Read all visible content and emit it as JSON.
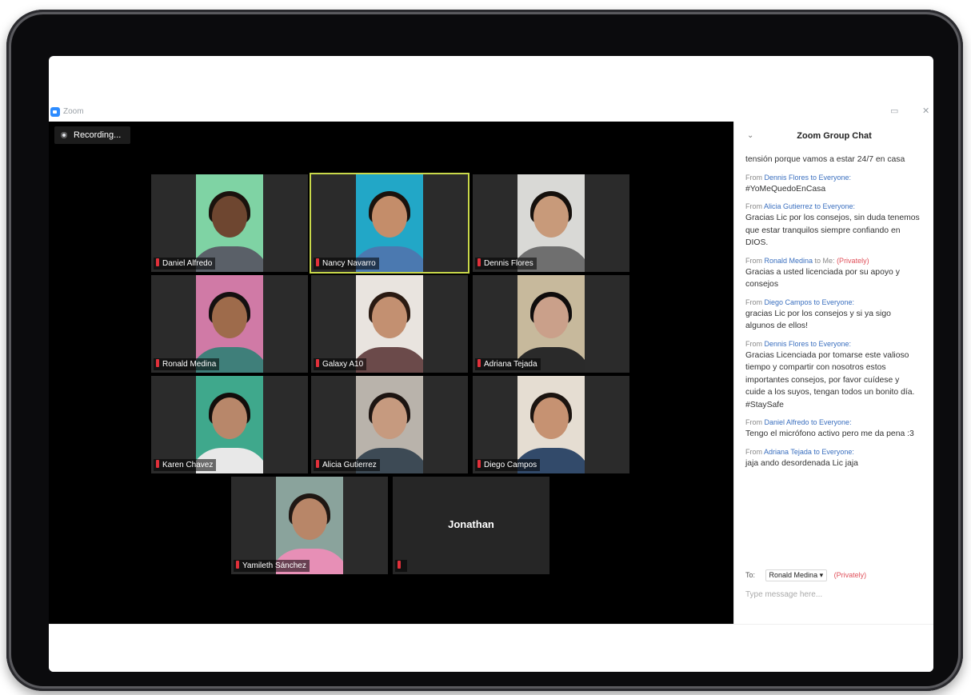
{
  "app": {
    "title": "Zoom",
    "minimize": "▭",
    "close": "✕"
  },
  "recording": {
    "label": "Recording..."
  },
  "participants": [
    {
      "name": "Daniel Alfredo",
      "bg": "#7fd3a4",
      "skin": "#6e4630",
      "hair": "#1a120d",
      "shirt": "#5a6068"
    },
    {
      "name": "Nancy Navarro",
      "bg": "#22a7c7",
      "skin": "#c48d6a",
      "hair": "#1a120d",
      "shirt": "#4b79b0",
      "active": true
    },
    {
      "name": "Dennis Flores",
      "bg": "#d9d9d6",
      "skin": "#c89a7a",
      "hair": "#15100c",
      "shirt": "#6f6f6f"
    },
    {
      "name": "Ronald Medina",
      "bg": "#d07aa6",
      "skin": "#9e6b4b",
      "hair": "#141010",
      "shirt": "#3f7f7a"
    },
    {
      "name": "Galaxy A10",
      "bg": "#e9e4df",
      "skin": "#c39071",
      "hair": "#2a1a12",
      "shirt": "#6b4a4a"
    },
    {
      "name": "Adriana Tejada",
      "bg": "#c7b99c",
      "skin": "#caa08a",
      "hair": "#0f0c0c",
      "shirt": "#2a2a2a"
    },
    {
      "name": "Karen Chavez",
      "bg": "#3fa88c",
      "skin": "#b8876a",
      "hair": "#120d0b",
      "shirt": "#e8e8e8"
    },
    {
      "name": "Alicia Gutierrez",
      "bg": "#b9b3ab",
      "skin": "#c69a7f",
      "hair": "#1c1411",
      "shirt": "#3d4a55"
    },
    {
      "name": "Diego Campos",
      "bg": "#e5ddd2",
      "skin": "#c69272",
      "hair": "#1b1410",
      "shirt": "#324a6a"
    },
    {
      "name": "Yamileth Sánchez",
      "bg": "#8aa39c",
      "skin": "#b88668",
      "hair": "#1f1713",
      "shirt": "#e78fb6"
    },
    {
      "name": "Jonathan",
      "no_video": true
    }
  ],
  "chat": {
    "title": "Zoom Group Chat",
    "messages": [
      {
        "from_name": "",
        "from_suffix": "",
        "private": "",
        "text": "tensión porque vamos a estar 24/7 en casa"
      },
      {
        "from_name": "Dennis Flores to Everyone:",
        "from_suffix": "",
        "private": "",
        "text": "#YoMeQuedoEnCasa"
      },
      {
        "from_name": "Alicia Gutierrez to Everyone:",
        "from_suffix": "",
        "private": "",
        "text": "Gracias Lic por los consejos, sin duda tenemos que estar tranquilos siempre confiando en DIOS."
      },
      {
        "from_name": "Ronald Medina",
        "from_suffix": "to Me:",
        "private": "(Privately)",
        "text": "Gracias a usted licenciada por su apoyo y consejos"
      },
      {
        "from_name": "Diego Campos to Everyone:",
        "from_suffix": "",
        "private": "",
        "text": "gracias Lic por los consejos y si ya sigo algunos de ellos!"
      },
      {
        "from_name": "Dennis Flores to Everyone:",
        "from_suffix": "",
        "private": "",
        "text": "Gracias Licenciada por tomarse este valioso tiempo y compartir con nosotros estos importantes consejos, por favor cuídese y cuide a los suyos, tengan todos un bonito día. #StaySafe"
      },
      {
        "from_name": "Daniel Alfredo to Everyone:",
        "from_suffix": "",
        "private": "",
        "text": "Tengo el micrófono activo pero me da pena :3"
      },
      {
        "from_name": "Adriana Tejada to Everyone:",
        "from_suffix": "",
        "private": "",
        "text": "jaja ando desordenada Lic jaja"
      }
    ],
    "to_label": "To:",
    "to_value": "Ronald Medina ▾",
    "to_private": "(Privately)",
    "input_placeholder": "Type message here..."
  }
}
